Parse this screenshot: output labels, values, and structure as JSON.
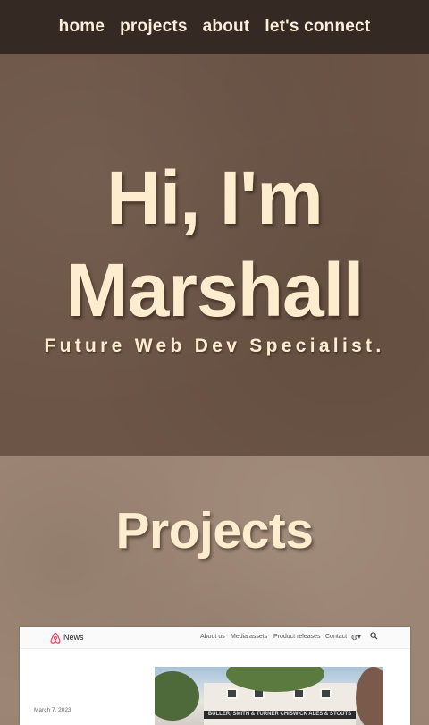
{
  "nav": {
    "items": [
      {
        "label": "home"
      },
      {
        "label": "projects"
      },
      {
        "label": "about"
      },
      {
        "label": "let's connect"
      }
    ]
  },
  "hero": {
    "greeting_line1": "Hi, I'm",
    "greeting_line2": "Marshall",
    "subtitle": "Future Web Dev Specialist."
  },
  "projects": {
    "heading": "Projects",
    "card_preview": {
      "brand": "News",
      "nav": [
        "About us",
        "Media assets",
        "Product releases",
        "Contact"
      ],
      "date": "March 7, 2023",
      "sign_text": "BULLER, SMITH & TURNER  CHISWICK ALES & STOUTS"
    }
  },
  "colors": {
    "nav_bg": "#352a23",
    "hero_bg": "#6c5546",
    "text_cream": "#fdeccd",
    "projects_bg": "#9c8574",
    "brand_accent": "#ff385c"
  }
}
